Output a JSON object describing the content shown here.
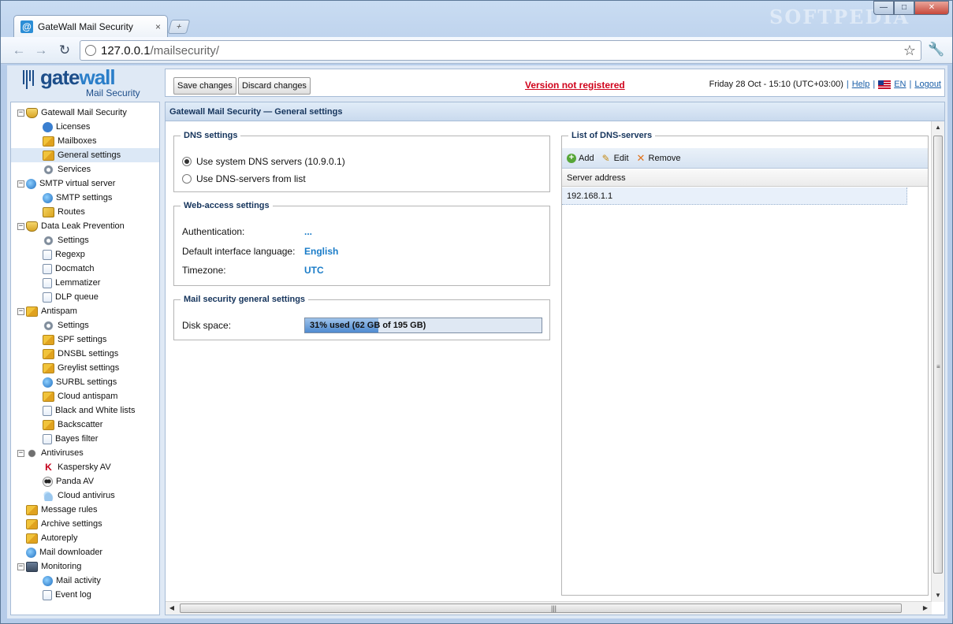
{
  "browser": {
    "tab_title": "GateWall Mail Security",
    "tab_close": "×",
    "new_tab": "+",
    "url_host": "127.0.0.1",
    "url_path": "/mailsecurity/",
    "watermark": "SOFTPEDIA",
    "win_min": "—",
    "win_max": "□",
    "win_close": "✕",
    "back_glyph": "←",
    "forward_glyph": "→",
    "reload_glyph": "↻",
    "star_glyph": "☆",
    "wrench_glyph": "🔧"
  },
  "logo": {
    "brand_gate": "gate",
    "brand_wall": "wall",
    "subtitle": "Mail Security"
  },
  "header": {
    "save_label": "Save changes",
    "discard_label": "Discard changes",
    "version_warning": "Version not registered",
    "datetime": "Friday 28 Oct - 15:10 (UTC+03:00)",
    "help": "Help",
    "lang": "EN",
    "logout": "Logout",
    "separator": "|"
  },
  "sidebar": {
    "items": [
      {
        "label": "Gatewall Mail Security",
        "level": 0,
        "expander": "−",
        "icon": "shield-icon"
      },
      {
        "label": "Licenses",
        "level": 1,
        "icon": "info-icon"
      },
      {
        "label": "Mailboxes",
        "level": 1,
        "icon": "mailbox-icon"
      },
      {
        "label": "General settings",
        "level": 1,
        "icon": "settings-icon",
        "selected": true
      },
      {
        "label": "Services",
        "level": 1,
        "icon": "services-icon"
      },
      {
        "label": "SMTP virtual server",
        "level": 0,
        "expander": "−",
        "icon": "globe-icon"
      },
      {
        "label": "SMTP settings",
        "level": 1,
        "icon": "smtp-icon"
      },
      {
        "label": "Routes",
        "level": 1,
        "icon": "route-icon"
      },
      {
        "label": "Data Leak Prevention",
        "level": 0,
        "expander": "−",
        "icon": "dlp-icon"
      },
      {
        "label": "Settings",
        "level": 1,
        "icon": "gear-icon"
      },
      {
        "label": "Regexp",
        "level": 1,
        "icon": "document-icon"
      },
      {
        "label": "Docmatch",
        "level": 1,
        "icon": "document-icon"
      },
      {
        "label": "Lemmatizer",
        "level": 1,
        "icon": "document-icon"
      },
      {
        "label": "DLP queue",
        "level": 1,
        "icon": "queue-icon"
      },
      {
        "label": "Antispam",
        "level": 0,
        "expander": "−",
        "icon": "antispam-icon"
      },
      {
        "label": "Settings",
        "level": 1,
        "icon": "gear-icon"
      },
      {
        "label": "SPF settings",
        "level": 1,
        "icon": "envelope-icon"
      },
      {
        "label": "DNSBL settings",
        "level": 1,
        "icon": "envelope-icon"
      },
      {
        "label": "Greylist settings",
        "level": 1,
        "icon": "greylist-icon"
      },
      {
        "label": "SURBL settings",
        "level": 1,
        "icon": "surbl-icon"
      },
      {
        "label": "Cloud antispam",
        "level": 1,
        "icon": "envelope-icon"
      },
      {
        "label": "Black and White lists",
        "level": 1,
        "icon": "document-icon"
      },
      {
        "label": "Backscatter",
        "level": 1,
        "icon": "envelope-icon"
      },
      {
        "label": "Bayes filter",
        "level": 1,
        "icon": "document-icon"
      },
      {
        "label": "Antiviruses",
        "level": 0,
        "expander": "−",
        "icon": "bug-icon"
      },
      {
        "label": "Kaspersky AV",
        "level": 1,
        "icon": "kaspersky-icon",
        "glyph": "K"
      },
      {
        "label": "Panda AV",
        "level": 1,
        "icon": "panda-icon"
      },
      {
        "label": "Cloud antivirus",
        "level": 1,
        "icon": "cloud-icon"
      },
      {
        "label": "Message rules",
        "level": 0,
        "icon": "envelope-icon"
      },
      {
        "label": "Archive settings",
        "level": 0,
        "icon": "envelope-icon"
      },
      {
        "label": "Autoreply",
        "level": 0,
        "icon": "envelope-icon"
      },
      {
        "label": "Mail downloader",
        "level": 0,
        "icon": "globe-icon"
      },
      {
        "label": "Monitoring",
        "level": 0,
        "expander": "−",
        "icon": "monitor-icon"
      },
      {
        "label": "Mail activity",
        "level": 1,
        "icon": "activity-icon"
      },
      {
        "label": "Event log",
        "level": 1,
        "icon": "document-icon"
      }
    ]
  },
  "main": {
    "title": "Gatewall Mail Security — General settings",
    "dns_settings": {
      "legend": "DNS settings",
      "option_system": "Use system DNS servers (10.9.0.1)",
      "option_list": "Use DNS-servers from list",
      "selected": "system"
    },
    "web_access": {
      "legend": "Web-access settings",
      "auth_label": "Authentication:",
      "auth_value": "...",
      "lang_label": "Default interface language:",
      "lang_value": "English",
      "tz_label": "Timezone:",
      "tz_value": "UTC"
    },
    "mail_security": {
      "legend": "Mail security general settings",
      "disk_label": "Disk space:",
      "disk_text": "31% used (62 GB of 195 GB)",
      "disk_used_fraction": 0.31
    },
    "dns_list": {
      "legend": "List of DNS-servers",
      "add": "Add",
      "edit": "Edit",
      "remove": "Remove",
      "column": "Server address",
      "rows": [
        "192.168.1.1"
      ]
    }
  },
  "scroll": {
    "up": "▲",
    "down": "▼",
    "left": "◀",
    "right": "▶",
    "vgrip": "≡",
    "hgrip": "|||"
  }
}
